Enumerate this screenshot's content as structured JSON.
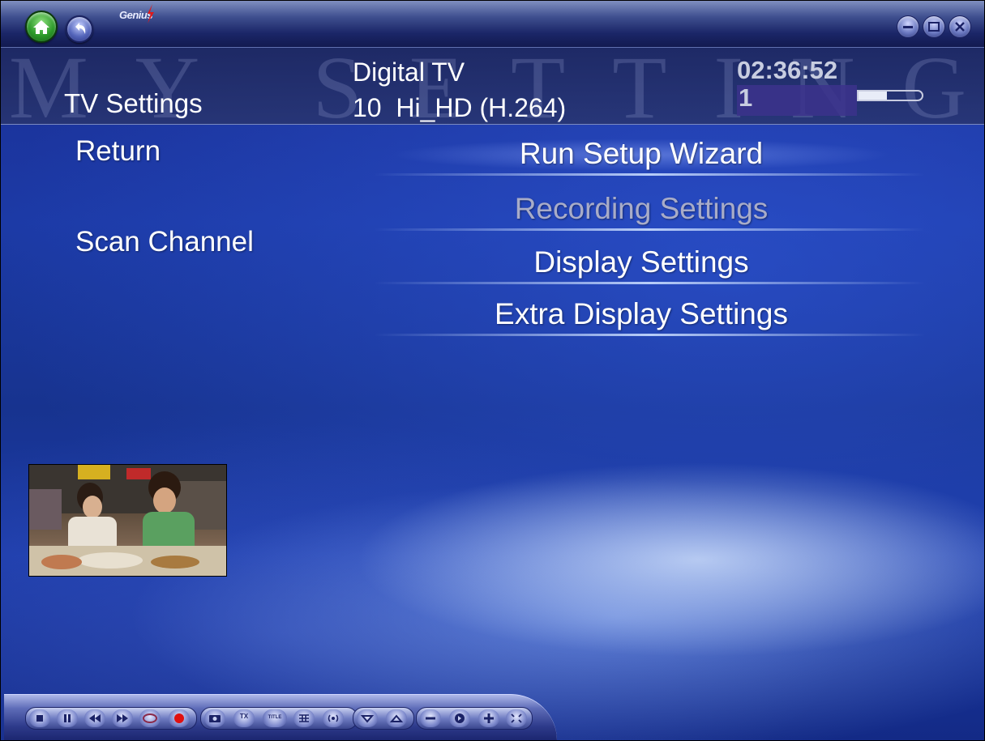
{
  "app": {
    "brand": "Genius"
  },
  "header": {
    "watermark": "MY SETTINGS",
    "section_title": "TV Settings",
    "source": "Digital TV",
    "channel_number": "10",
    "channel_name": "Hi_HD (H.264)",
    "channel_line": "10  Hi_HD (H.264)",
    "clock": "02:36:52",
    "sub_number": "1",
    "signal_level_percent": 45
  },
  "left_menu": [
    {
      "label": "Return"
    },
    {
      "label": "Scan Channel"
    }
  ],
  "settings_menu": [
    {
      "label": "Run Setup Wizard",
      "state": "selected"
    },
    {
      "label": "Recording Settings",
      "state": "disabled"
    },
    {
      "label": "Display Settings",
      "state": "normal"
    },
    {
      "label": "Extra Display Settings",
      "state": "normal"
    }
  ],
  "toolbar": {
    "buttons": [
      {
        "icon": "stop-icon"
      },
      {
        "icon": "pause-icon"
      },
      {
        "icon": "rewind-icon"
      },
      {
        "icon": "fast-forward-icon"
      },
      {
        "icon": "timeshift-icon"
      },
      {
        "icon": "record-icon"
      },
      {
        "icon": "snapshot-icon"
      },
      {
        "icon": "teletext-icon",
        "label": "TX"
      },
      {
        "icon": "title-icon",
        "label": "TITLE"
      },
      {
        "icon": "epg-grid-icon"
      },
      {
        "icon": "broadcast-icon"
      },
      {
        "icon": "channel-down-icon"
      },
      {
        "icon": "channel-up-icon"
      },
      {
        "icon": "volume-down-icon"
      },
      {
        "icon": "mute-icon"
      },
      {
        "icon": "volume-up-icon"
      },
      {
        "icon": "fullscreen-icon"
      }
    ]
  },
  "colors": {
    "background": "#1c3aa6",
    "disabled_text": "#a8acc8",
    "record_red": "#e01010",
    "home_green": "#2d9a2a"
  }
}
